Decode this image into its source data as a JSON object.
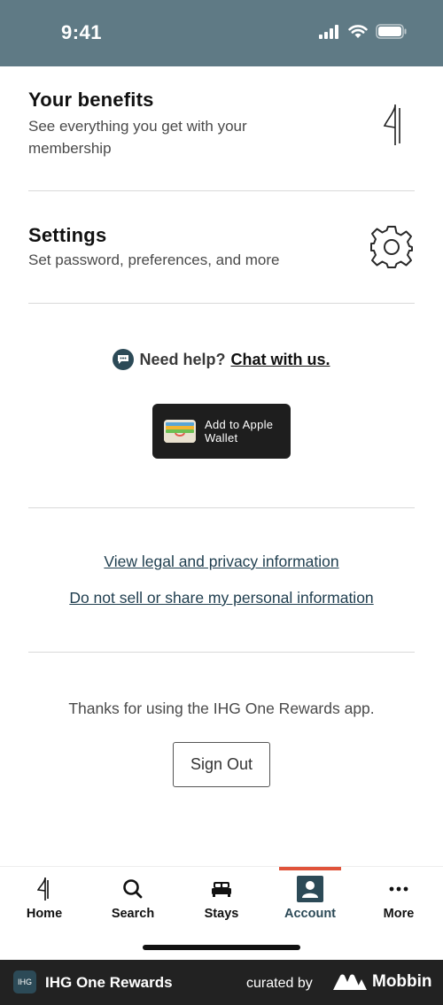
{
  "status": {
    "time": "9:41"
  },
  "benefits": {
    "title": "Your benefits",
    "subtitle": "See everything you get with your membership"
  },
  "settings": {
    "title": "Settings",
    "subtitle": "Set password, preferences, and more"
  },
  "help": {
    "text": "Need help?",
    "link": "Chat with us."
  },
  "wallet": {
    "label": "Add to Apple Wallet"
  },
  "legal": {
    "privacy_link": "View legal and privacy information",
    "do_not_sell_link": "Do not sell or share my personal information"
  },
  "thanks": "Thanks for using the IHG One Rewards app.",
  "signout": "Sign Out",
  "tabs": [
    {
      "label": "Home",
      "icon": "ihg-logo-icon"
    },
    {
      "label": "Search",
      "icon": "search-icon"
    },
    {
      "label": "Stays",
      "icon": "bed-icon"
    },
    {
      "label": "Account",
      "icon": "account-icon",
      "active": true
    },
    {
      "label": "More",
      "icon": "more-icon"
    }
  ],
  "footer": {
    "logo_text": "IHG",
    "app_name": "IHG One Rewards",
    "curated": "curated by",
    "brand": "Mobbin"
  },
  "colors": {
    "status_bar": "#5f7a85",
    "accent": "#e0533a",
    "brand_dark": "#2c4a57",
    "footer": "#222222"
  }
}
